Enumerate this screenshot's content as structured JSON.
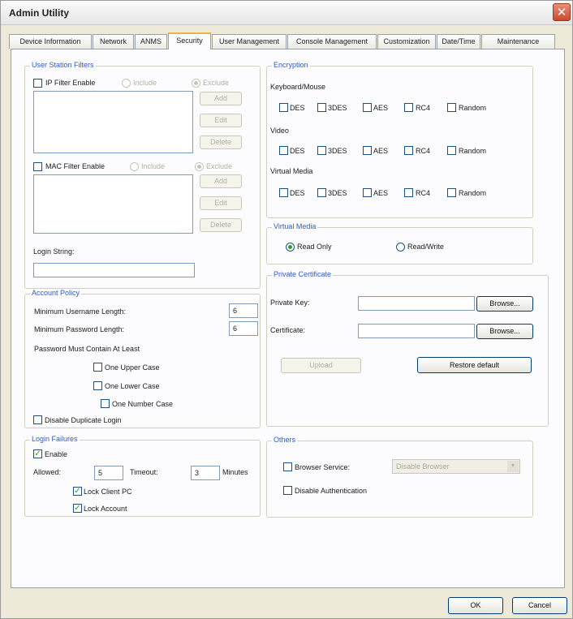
{
  "window": {
    "title": "Admin Utility",
    "close_glyph": "✕"
  },
  "tabs": [
    {
      "label": "Device Information"
    },
    {
      "label": "Network"
    },
    {
      "label": "ANMS"
    },
    {
      "label": "Security"
    },
    {
      "label": "User Management"
    },
    {
      "label": "Console Management"
    },
    {
      "label": "Customization"
    },
    {
      "label": "Date/Time"
    },
    {
      "label": "Maintenance"
    }
  ],
  "user_station_filters": {
    "legend": "User Station Filters",
    "ip_filter_label": "IP Filter Enable",
    "mac_filter_label": "MAC Filter Enable",
    "include_label": "Include",
    "exclude_label": "Exclude",
    "add_label": "Add",
    "edit_label": "Edit",
    "delete_label": "Delete",
    "login_string_label": "Login String:",
    "login_string_value": ""
  },
  "encryption": {
    "legend": "Encryption",
    "keyboard_mouse_label": "Keyboard/Mouse",
    "video_label": "Video",
    "virtual_media_label": "Virtual Media",
    "options": [
      "DES",
      "3DES",
      "AES",
      "RC4",
      "Random"
    ]
  },
  "virtual_media": {
    "legend": "Virtual Media",
    "read_only_label": "Read Only",
    "read_write_label": "Read/Write"
  },
  "private_certificate": {
    "legend": "Private Certificate",
    "private_key_label": "Private Key:",
    "certificate_label": "Certificate:",
    "browse_label": "Browse...",
    "upload_label": "Upload",
    "restore_label": "Restore default"
  },
  "account_policy": {
    "legend": "Account Policy",
    "min_username_label": "Minimum Username Length:",
    "min_username_value": "6",
    "min_password_label": "Minimum Password Length:",
    "min_password_value": "6",
    "must_contain_label": "Password Must Contain At Least",
    "upper_label": "One Upper Case",
    "lower_label": "One Lower Case",
    "number_label": "One Number Case",
    "disable_dup_label": "Disable Duplicate Login"
  },
  "login_failures": {
    "legend": "Login Failures",
    "enable_label": "Enable",
    "allowed_label": "Allowed:",
    "allowed_value": "5",
    "timeout_label": "Timeout:",
    "timeout_value": "3",
    "minutes_label": "Minutes",
    "lock_pc_label": "Lock Client PC",
    "lock_account_label": "Lock Account",
    "check_glyph": "✓"
  },
  "others": {
    "legend": "Others",
    "browser_service_label": "Browser Service:",
    "browser_service_value": "Disable Browser",
    "disable_auth_label": "Disable Authentication"
  },
  "footer": {
    "ok_label": "OK",
    "cancel_label": "Cancel"
  }
}
